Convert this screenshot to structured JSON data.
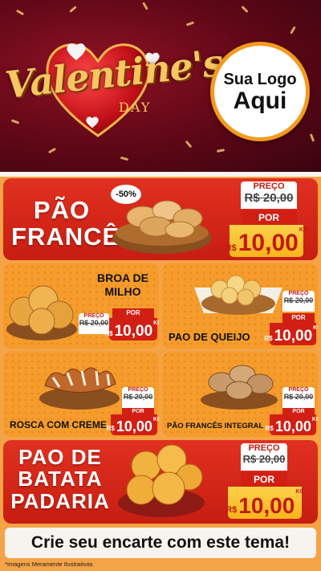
{
  "header": {
    "valentine": "Valentine's",
    "day": "DAY",
    "logo_line1": "Sua Logo",
    "logo_line2": "Aqui"
  },
  "products": {
    "pao_frances": {
      "name_line1": "PÃO",
      "name_line2": "FRANCÊS",
      "discount": "-50%",
      "preco_label": "PREÇO",
      "old_price": "R$ 20,00",
      "por_label": "POR",
      "currency": "R$",
      "new_price": "10,00",
      "unit": "KG"
    },
    "broa": {
      "name_line1": "BROA DE",
      "name_line2": "MILHO",
      "preco_label": "PREÇO",
      "old_price": "R$ 20,00",
      "por_label": "POR",
      "currency": "R$",
      "new_price": "10,00",
      "unit": "KG"
    },
    "pao_queijo": {
      "name": "PAO DE QUEIJO",
      "preco_label": "PREÇO",
      "old_price": "R$ 20,00",
      "por_label": "POR",
      "currency": "R$",
      "new_price": "10,00",
      "unit": "KG"
    },
    "rosca": {
      "name": "ROSCA COM CREME",
      "preco_label": "PREÇO",
      "old_price": "R$ 20,00",
      "por_label": "POR",
      "currency": "R$",
      "new_price": "10,00",
      "unit": "KG"
    },
    "pao_integral": {
      "name": "PÃO FRANCÊS INTEGRAL",
      "preco_label": "PREÇO",
      "old_price": "R$ 20,00",
      "por_label": "POR",
      "currency": "R$",
      "new_price": "10,00",
      "unit": "KG"
    },
    "pao_batata": {
      "name_line1": "PAO DE",
      "name_line2": "BATATA",
      "name_line3": "PADARIA",
      "preco_label": "PREÇO",
      "old_price": "R$ 20,00",
      "por_label": "POR",
      "currency": "R$",
      "new_price": "10,00",
      "unit": "KG"
    }
  },
  "cta": "Crie seu encarte com este tema!",
  "footnote": "*Imagens Meramente Ilustrativas",
  "colors": {
    "red": "#d21f13",
    "orange": "#f59c2c",
    "yellow": "#f7b51a",
    "wine": "#5e0716"
  }
}
